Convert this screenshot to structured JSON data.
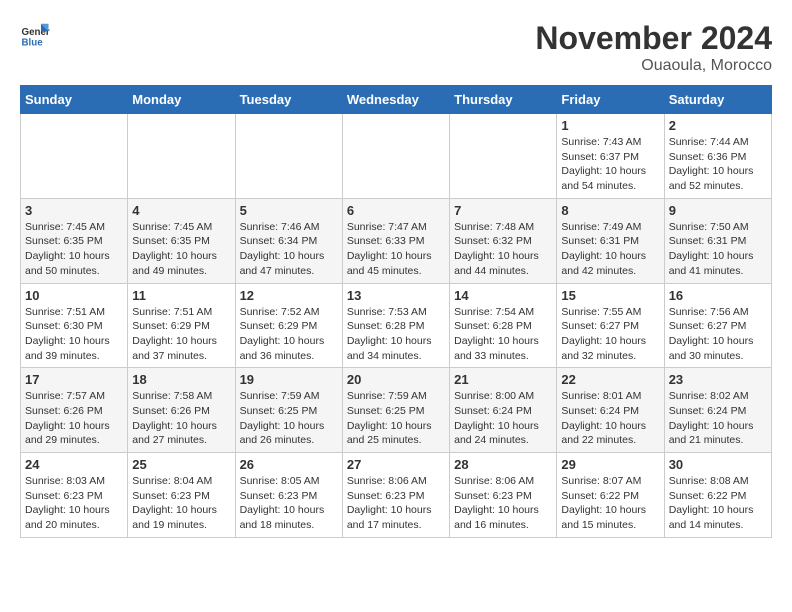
{
  "header": {
    "logo_line1": "General",
    "logo_line2": "Blue",
    "month_title": "November 2024",
    "location": "Ouaoula, Morocco"
  },
  "weekdays": [
    "Sunday",
    "Monday",
    "Tuesday",
    "Wednesday",
    "Thursday",
    "Friday",
    "Saturday"
  ],
  "weeks": [
    [
      {
        "day": "",
        "info": ""
      },
      {
        "day": "",
        "info": ""
      },
      {
        "day": "",
        "info": ""
      },
      {
        "day": "",
        "info": ""
      },
      {
        "day": "",
        "info": ""
      },
      {
        "day": "1",
        "info": "Sunrise: 7:43 AM\nSunset: 6:37 PM\nDaylight: 10 hours and 54 minutes."
      },
      {
        "day": "2",
        "info": "Sunrise: 7:44 AM\nSunset: 6:36 PM\nDaylight: 10 hours and 52 minutes."
      }
    ],
    [
      {
        "day": "3",
        "info": "Sunrise: 7:45 AM\nSunset: 6:35 PM\nDaylight: 10 hours and 50 minutes."
      },
      {
        "day": "4",
        "info": "Sunrise: 7:45 AM\nSunset: 6:35 PM\nDaylight: 10 hours and 49 minutes."
      },
      {
        "day": "5",
        "info": "Sunrise: 7:46 AM\nSunset: 6:34 PM\nDaylight: 10 hours and 47 minutes."
      },
      {
        "day": "6",
        "info": "Sunrise: 7:47 AM\nSunset: 6:33 PM\nDaylight: 10 hours and 45 minutes."
      },
      {
        "day": "7",
        "info": "Sunrise: 7:48 AM\nSunset: 6:32 PM\nDaylight: 10 hours and 44 minutes."
      },
      {
        "day": "8",
        "info": "Sunrise: 7:49 AM\nSunset: 6:31 PM\nDaylight: 10 hours and 42 minutes."
      },
      {
        "day": "9",
        "info": "Sunrise: 7:50 AM\nSunset: 6:31 PM\nDaylight: 10 hours and 41 minutes."
      }
    ],
    [
      {
        "day": "10",
        "info": "Sunrise: 7:51 AM\nSunset: 6:30 PM\nDaylight: 10 hours and 39 minutes."
      },
      {
        "day": "11",
        "info": "Sunrise: 7:51 AM\nSunset: 6:29 PM\nDaylight: 10 hours and 37 minutes."
      },
      {
        "day": "12",
        "info": "Sunrise: 7:52 AM\nSunset: 6:29 PM\nDaylight: 10 hours and 36 minutes."
      },
      {
        "day": "13",
        "info": "Sunrise: 7:53 AM\nSunset: 6:28 PM\nDaylight: 10 hours and 34 minutes."
      },
      {
        "day": "14",
        "info": "Sunrise: 7:54 AM\nSunset: 6:28 PM\nDaylight: 10 hours and 33 minutes."
      },
      {
        "day": "15",
        "info": "Sunrise: 7:55 AM\nSunset: 6:27 PM\nDaylight: 10 hours and 32 minutes."
      },
      {
        "day": "16",
        "info": "Sunrise: 7:56 AM\nSunset: 6:27 PM\nDaylight: 10 hours and 30 minutes."
      }
    ],
    [
      {
        "day": "17",
        "info": "Sunrise: 7:57 AM\nSunset: 6:26 PM\nDaylight: 10 hours and 29 minutes."
      },
      {
        "day": "18",
        "info": "Sunrise: 7:58 AM\nSunset: 6:26 PM\nDaylight: 10 hours and 27 minutes."
      },
      {
        "day": "19",
        "info": "Sunrise: 7:59 AM\nSunset: 6:25 PM\nDaylight: 10 hours and 26 minutes."
      },
      {
        "day": "20",
        "info": "Sunrise: 7:59 AM\nSunset: 6:25 PM\nDaylight: 10 hours and 25 minutes."
      },
      {
        "day": "21",
        "info": "Sunrise: 8:00 AM\nSunset: 6:24 PM\nDaylight: 10 hours and 24 minutes."
      },
      {
        "day": "22",
        "info": "Sunrise: 8:01 AM\nSunset: 6:24 PM\nDaylight: 10 hours and 22 minutes."
      },
      {
        "day": "23",
        "info": "Sunrise: 8:02 AM\nSunset: 6:24 PM\nDaylight: 10 hours and 21 minutes."
      }
    ],
    [
      {
        "day": "24",
        "info": "Sunrise: 8:03 AM\nSunset: 6:23 PM\nDaylight: 10 hours and 20 minutes."
      },
      {
        "day": "25",
        "info": "Sunrise: 8:04 AM\nSunset: 6:23 PM\nDaylight: 10 hours and 19 minutes."
      },
      {
        "day": "26",
        "info": "Sunrise: 8:05 AM\nSunset: 6:23 PM\nDaylight: 10 hours and 18 minutes."
      },
      {
        "day": "27",
        "info": "Sunrise: 8:06 AM\nSunset: 6:23 PM\nDaylight: 10 hours and 17 minutes."
      },
      {
        "day": "28",
        "info": "Sunrise: 8:06 AM\nSunset: 6:23 PM\nDaylight: 10 hours and 16 minutes."
      },
      {
        "day": "29",
        "info": "Sunrise: 8:07 AM\nSunset: 6:22 PM\nDaylight: 10 hours and 15 minutes."
      },
      {
        "day": "30",
        "info": "Sunrise: 8:08 AM\nSunset: 6:22 PM\nDaylight: 10 hours and 14 minutes."
      }
    ]
  ]
}
